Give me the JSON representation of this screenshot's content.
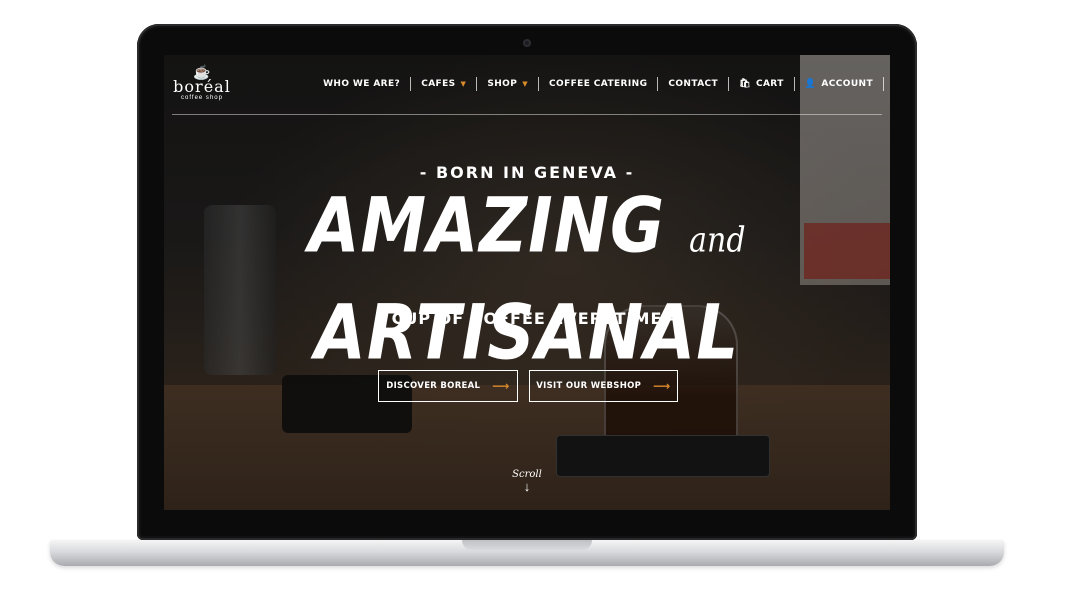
{
  "site": {
    "logo": {
      "name": "boréal",
      "tagline": "coffee shop"
    },
    "nav": [
      {
        "label": "WHO WE ARE?",
        "has_dropdown": false
      },
      {
        "label": "CAFES",
        "has_dropdown": true
      },
      {
        "label": "SHOP",
        "has_dropdown": true
      },
      {
        "label": "COFFEE CATERING",
        "has_dropdown": false
      },
      {
        "label": "CONTACT",
        "has_dropdown": false
      },
      {
        "label": "CART",
        "icon": "bag-icon"
      },
      {
        "label": "ACCOUNT",
        "icon": "user-icon"
      }
    ],
    "hero": {
      "kicker": "- BORN IN GENEVA -",
      "headline_left": "AMAZING",
      "headline_mid": "and",
      "headline_right": "ARTISANAL",
      "subline": "- CUP OF COFFEE EVERYTIME -",
      "buttons": [
        {
          "label": "DISCOVER BOREAL",
          "icon": "arrow-right-icon"
        },
        {
          "label": "VISIT OUR WEBSHOP",
          "icon": "arrow-right-icon"
        }
      ],
      "scroll_label": "Scroll",
      "scroll_icon": "arrow-down-icon"
    },
    "colors": {
      "accent": "#d98a2b",
      "text": "#ffffff"
    }
  }
}
